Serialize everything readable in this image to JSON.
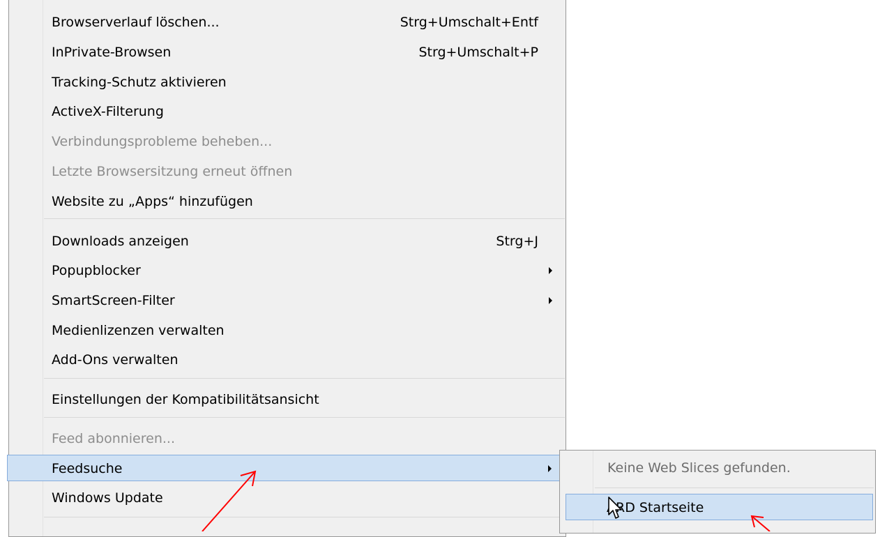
{
  "menu": {
    "items": [
      {
        "label": "Browserverlauf löschen...",
        "shortcut": "Strg+Umschalt+Entf"
      },
      {
        "label": "InPrivate-Browsen",
        "shortcut": "Strg+Umschalt+P"
      },
      {
        "label": "Tracking-Schutz aktivieren"
      },
      {
        "label": "ActiveX-Filterung"
      },
      {
        "label": "Verbindungsprobleme beheben...",
        "disabled": true
      },
      {
        "label": "Letzte Browsersitzung erneut öffnen",
        "disabled": true
      },
      {
        "label": "Website zu „Apps“ hinzufügen"
      },
      {
        "label": "Downloads anzeigen",
        "shortcut": "Strg+J"
      },
      {
        "label": "Popupblocker",
        "submenu": true
      },
      {
        "label": "SmartScreen-Filter",
        "submenu": true
      },
      {
        "label": "Medienlizenzen verwalten"
      },
      {
        "label": "Add-Ons verwalten"
      },
      {
        "label": "Einstellungen der Kompatibilitätsansicht"
      },
      {
        "label": "Feed abonnieren...",
        "disabled": true
      },
      {
        "label": "Feedsuche",
        "submenu": true,
        "highlighted": true
      },
      {
        "label": "Windows Update"
      }
    ]
  },
  "submenu": {
    "items": [
      {
        "label": "Keine Web Slices gefunden.",
        "disabled": true
      },
      {
        "label": "ARD Startseite",
        "highlighted": true
      }
    ]
  },
  "colors": {
    "menu_bg": "#f0f0f0",
    "highlight_bg": "#cfe1f4",
    "highlight_border": "#84acdd",
    "disabled_text": "#8d8d8d",
    "annotation_arrow": "#ff0000"
  }
}
